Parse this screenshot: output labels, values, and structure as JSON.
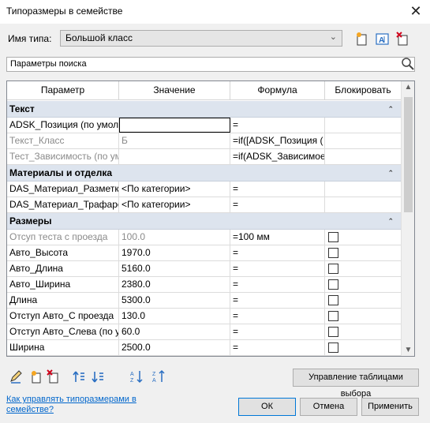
{
  "window": {
    "title": "Типоразмеры в семействе",
    "close_glyph": "✕"
  },
  "type_name": {
    "label": "Имя типа:",
    "value": "Большой класс"
  },
  "search": {
    "placeholder": "Параметры поиска"
  },
  "columns": [
    "Параметр",
    "Значение",
    "Формула",
    "Блокировать"
  ],
  "groups": [
    {
      "name": "Текст",
      "rows": [
        {
          "param": "ADSK_Позиция (по умол",
          "value": "",
          "formula": "=",
          "lock": false,
          "has_lock": false,
          "grey": false,
          "editing": true
        },
        {
          "param": "Текст_Класс",
          "value": "Б",
          "formula": "=if([ADSK_Позиция (",
          "lock": false,
          "has_lock": false,
          "grey": true
        },
        {
          "param": "Тест_Зависимость (по ум",
          "value": "",
          "formula": "=if(ADSK_Зависимое",
          "lock": false,
          "has_lock": false,
          "grey": true
        }
      ]
    },
    {
      "name": "Материалы и отделка",
      "rows": [
        {
          "param": "DAS_Материал_Разметка",
          "value": "<По категории>",
          "formula": "=",
          "has_lock": false,
          "grey": false
        },
        {
          "param": "DAS_Материал_Трафаре",
          "value": "<По категории>",
          "formula": "=",
          "has_lock": false,
          "grey": false
        }
      ]
    },
    {
      "name": "Размеры",
      "rows": [
        {
          "param": "Отсуп теста с проезда",
          "value": "100.0",
          "formula": "=100 мм",
          "lock": false,
          "has_lock": true,
          "grey": true
        },
        {
          "param": "Авто_Высота",
          "value": "1970.0",
          "formula": "=",
          "lock": false,
          "has_lock": true,
          "grey": false
        },
        {
          "param": "Авто_Длина",
          "value": "5160.0",
          "formula": "=",
          "lock": false,
          "has_lock": true,
          "grey": false
        },
        {
          "param": "Авто_Ширина",
          "value": "2380.0",
          "formula": "=",
          "lock": false,
          "has_lock": true,
          "grey": false
        },
        {
          "param": "Длина",
          "value": "5300.0",
          "formula": "=",
          "lock": false,
          "has_lock": true,
          "grey": false
        },
        {
          "param": "Отступ Авто_С проезда",
          "value": "130.0",
          "formula": "=",
          "lock": false,
          "has_lock": true,
          "grey": false
        },
        {
          "param": "Отступ Авто_Слева (по у",
          "value": "60.0",
          "formula": "=",
          "lock": false,
          "has_lock": true,
          "grey": false
        },
        {
          "param": "Ширина",
          "value": "2500.0",
          "formula": "=",
          "lock": false,
          "has_lock": true,
          "grey": false
        }
      ]
    }
  ],
  "buttons": {
    "lookup_tables": "Управление таблицами выбора",
    "ok": "ОК",
    "cancel": "Отмена",
    "apply": "Применить"
  },
  "help_link": "Как управлять типоразмерами в семействе?",
  "icons": {
    "new_type": "new-type-icon",
    "rename_type": "rename-type-icon",
    "delete_type": "delete-type-icon",
    "search": "search-icon",
    "edit_param": "pencil-icon",
    "new_param": "new-parameter-icon",
    "delete_param": "delete-parameter-icon",
    "move_up": "move-up-icon",
    "move_down": "move-down-icon",
    "sort_asc": "sort-ascending-icon",
    "sort_desc": "sort-descending-icon"
  },
  "colors": {
    "group_header": "#dde4ee",
    "link": "#0066cc",
    "accent": "#0078d7"
  }
}
